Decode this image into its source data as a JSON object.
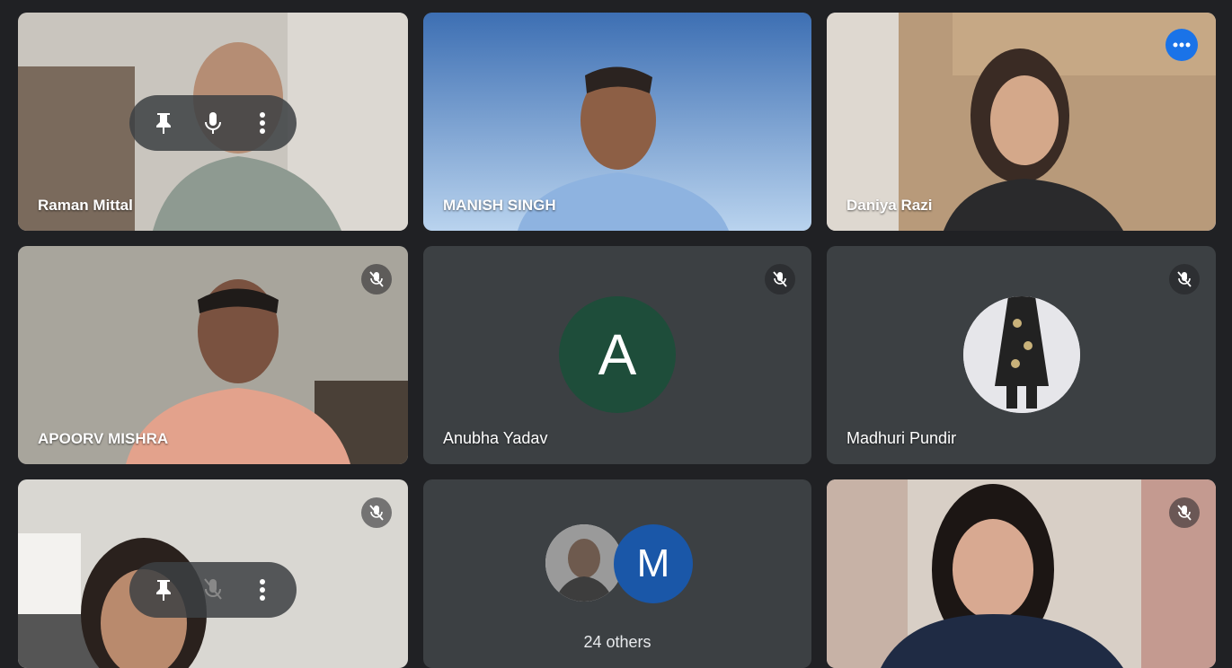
{
  "participants": {
    "raman": {
      "name": "Raman Mittal"
    },
    "manish": {
      "name": "MANISH SINGH"
    },
    "daniya": {
      "name": "Daniya Razi"
    },
    "apoorv": {
      "name": "APOORV MISHRA"
    },
    "anubha": {
      "name": "Anubha Yadav",
      "avatar_letter": "A",
      "avatar_color": "#1e4d3a"
    },
    "madhuri": {
      "name": "Madhuri Pundir"
    },
    "tile7": {},
    "others": {
      "count_label": "24 others",
      "avatar_letter": "M",
      "avatar_color": "#1a57a8"
    },
    "tile9": {}
  },
  "icons": {
    "pin": "pin-icon",
    "mic": "microphone-icon",
    "mic_off": "microphone-off-icon",
    "more": "more-vert-icon",
    "more_h": "more-horiz-icon"
  },
  "colors": {
    "background": "#202124",
    "tile": "#3c4043",
    "accent": "#1a73e8",
    "selected_border": "#8ab4f8"
  }
}
